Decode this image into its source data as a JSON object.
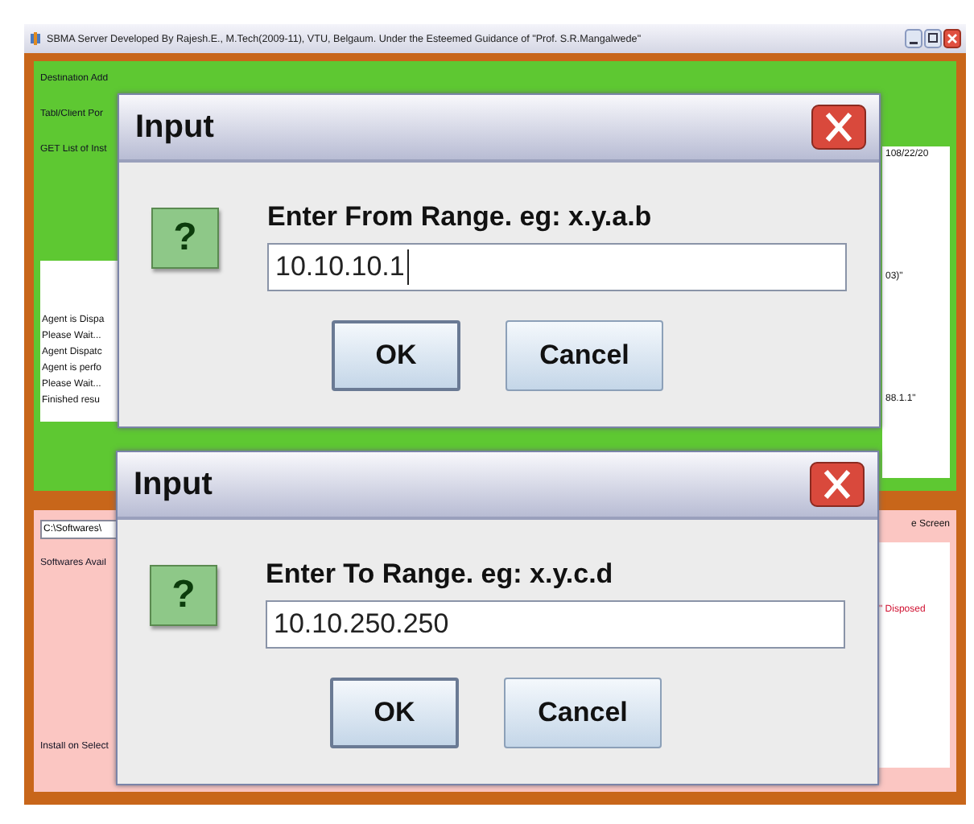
{
  "window": {
    "title": "SBMA Server    Developed By    Rajesh.E., M.Tech(2009-11), VTU, Belgaum.    Under the Esteemed Guidance of    \"Prof. S.R.Mangalwede\""
  },
  "top_panel": {
    "labels": [
      "Destination Add",
      "Tabl/Client Por",
      "GET List of Inst"
    ],
    "log_lines": [
      "Agent is Dispa",
      "Please Wait...",
      "Agent Dispatc",
      "Agent is perfo",
      "Please Wait...",
      "Finished resu"
    ],
    "right_texts": [
      "108/22/20",
      "03)\"",
      "88.1.1\""
    ]
  },
  "bottom_panel": {
    "path_field": "C:\\Softwares\\",
    "labels": [
      "Softwares Avail",
      "Install on Select"
    ],
    "right_texts": [
      "e Screen",
      "\" Disposed"
    ]
  },
  "dialogs": [
    {
      "title": "Input",
      "icon_glyph": "?",
      "prompt": "Enter From Range. eg: x.y.a.b",
      "value": "10.10.10.1",
      "focused": true,
      "buttons": [
        "OK",
        "Cancel"
      ]
    },
    {
      "title": "Input",
      "icon_glyph": "?",
      "prompt": "Enter To Range. eg: x.y.c.d",
      "value": "10.10.250.250",
      "focused": false,
      "buttons": [
        "OK",
        "Cancel"
      ]
    }
  ]
}
